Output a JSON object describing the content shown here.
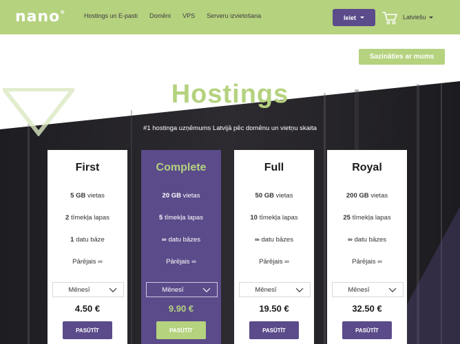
{
  "header": {
    "logo": "nano",
    "logo_mark": "®",
    "nav": [
      {
        "label": "Hostings un E-pasti"
      },
      {
        "label": "Domēni"
      },
      {
        "label": "VPS"
      },
      {
        "label": "Serveru izvietošana"
      }
    ],
    "login_label": "Ieiet",
    "cart_icon": "cart-icon",
    "language": "Latviešu"
  },
  "hero": {
    "contact_label": "Sazināties ar mums",
    "title": "Hostings",
    "subtitle": "#1 hostinga uzņēmums Latvijā pēc domēnu un vietņu skaita"
  },
  "plans": [
    {
      "name": "First",
      "storage_value": "5 GB",
      "storage_unit": "vietas",
      "sites_value": "2",
      "sites_unit": "tīmekļa lapas",
      "db_value": "1",
      "db_unit": "datu bāze",
      "traffic": "Pārējais ∞",
      "period": "Mēnesī",
      "price": "4.50 €",
      "order_label": "PASŪTĪT"
    },
    {
      "name": "Complete",
      "storage_value": "20 GB",
      "storage_unit": "vietas",
      "sites_value": "5",
      "sites_unit": "tīmekļa lapas",
      "db_value": "∞",
      "db_unit": "datu bāzes",
      "traffic": "Pārējais ∞",
      "period": "Mēnesī",
      "price": "9.90 €",
      "order_label": "PASŪTĪT"
    },
    {
      "name": "Full",
      "storage_value": "50 GB",
      "storage_unit": "vietas",
      "sites_value": "10",
      "sites_unit": "tīmekļa lapas",
      "db_value": "∞",
      "db_unit": "datu bāzes",
      "traffic": "Pārējais ∞",
      "period": "Mēnesī",
      "price": "19.50 €",
      "order_label": "PASŪTĪT"
    },
    {
      "name": "Royal",
      "storage_value": "200 GB",
      "storage_unit": "vietas",
      "sites_value": "25",
      "sites_unit": "tīmekļa lapas",
      "db_value": "∞",
      "db_unit": "datu bāzes",
      "traffic": "Pārējais ∞",
      "period": "Mēnesī",
      "price": "32.50 €",
      "order_label": "PASŪTĪT"
    }
  ],
  "colors": {
    "brand_green": "#b5d27f",
    "brand_purple": "#5b4b8a",
    "dark": "#262428"
  }
}
